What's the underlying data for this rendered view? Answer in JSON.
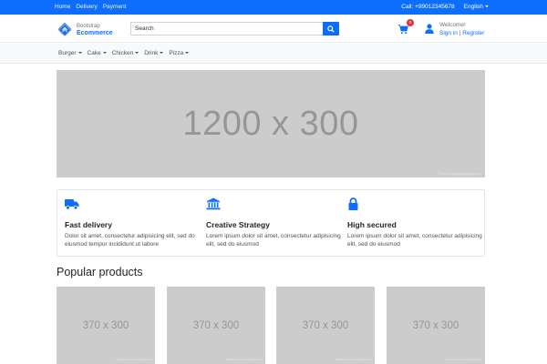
{
  "topbar": {
    "links": [
      "Home",
      "Delivery",
      "Payment"
    ],
    "phone": "Call: +99012345678",
    "language": "English"
  },
  "header": {
    "logo": {
      "subtitle": "Bootstrap",
      "name": "Ecommerce"
    },
    "search": {
      "placeholder": "Search",
      "value": ""
    },
    "cart_count": "0",
    "welcome": "Welcome!",
    "signin": "Sign in",
    "separator": "|",
    "register": "Register"
  },
  "categories": [
    "Burger",
    "Cake",
    "Chicken",
    "Drink",
    "Pizza"
  ],
  "banner": {
    "label": "1200 x 300",
    "credit": "Powered by dummyimage.com"
  },
  "features": [
    {
      "icon": "truck-icon",
      "title": "Fast delivery",
      "text": "Dolor sit amet, consectetur adipisicing elit, sed do eiusmod tempor incididunt ut labore"
    },
    {
      "icon": "bank-icon",
      "title": "Creative Strategy",
      "text": "Lorem ipsum dolor sit amet, consectetur adipisicing elit, sed do eiusmod"
    },
    {
      "icon": "lock-icon",
      "title": "High secured",
      "text": "Lorem ipsum dolor sit amet, consectetur adipisicing elit, sed do eiusmod"
    }
  ],
  "popular": {
    "title": "Popular products",
    "products": [
      {
        "label": "370 x 300",
        "credit": "Powered by dummyimage.com"
      },
      {
        "label": "370 x 300",
        "credit": "Powered by dummyimage.com"
      },
      {
        "label": "370 x 300",
        "credit": "Powered by dummyimage.com"
      },
      {
        "label": "370 x 300",
        "credit": "Powered by dummyimage.com"
      }
    ]
  },
  "colors": {
    "primary": "#0d6efd",
    "badge": "#dc3545",
    "placeholder": "#cccccc",
    "placeholder_text": "#969696"
  }
}
